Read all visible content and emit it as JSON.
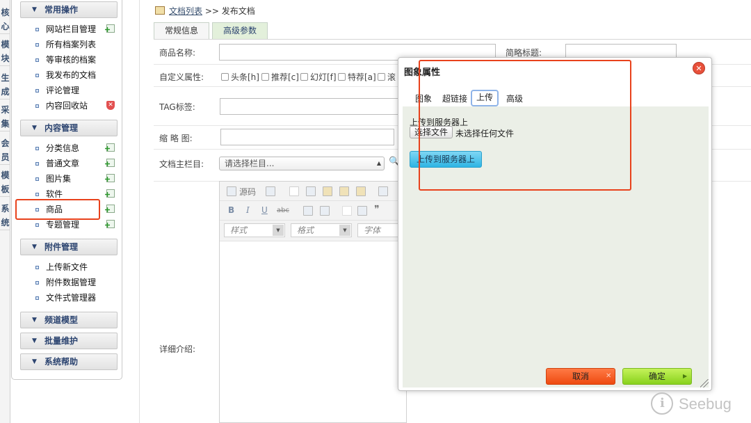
{
  "left_tabs": [
    "核心",
    "模块",
    "生成",
    "采集",
    "会员",
    "模板",
    "系统"
  ],
  "menu": {
    "groups": [
      {
        "title": "常用操作",
        "items": [
          {
            "label": "网站栏目管理",
            "action": "add"
          },
          {
            "label": "所有档案列表",
            "action": ""
          },
          {
            "label": "等审核的档案",
            "action": ""
          },
          {
            "label": "我发布的文档",
            "action": ""
          },
          {
            "label": "评论管理",
            "action": ""
          },
          {
            "label": "内容回收站",
            "action": "delete"
          }
        ]
      },
      {
        "title": "内容管理",
        "items": [
          {
            "label": "分类信息",
            "action": "add"
          },
          {
            "label": "普通文章",
            "action": "add"
          },
          {
            "label": "图片集",
            "action": "add"
          },
          {
            "label": "软件",
            "action": "add"
          },
          {
            "label": "商品",
            "action": "add"
          },
          {
            "label": "专题管理",
            "action": "add"
          }
        ]
      },
      {
        "title": "附件管理",
        "items": [
          {
            "label": "上传新文件",
            "action": ""
          },
          {
            "label": "附件数据管理",
            "action": ""
          },
          {
            "label": "文件式管理器",
            "action": ""
          }
        ]
      },
      {
        "title": "频道模型",
        "items": []
      },
      {
        "title": "批量维护",
        "items": []
      },
      {
        "title": "系统帮助",
        "items": []
      }
    ]
  },
  "breadcrumb": {
    "link": "文档列表",
    "sep": ">>",
    "current": "发布文档"
  },
  "tabs": [
    "常规信息",
    "高级参数"
  ],
  "form": {
    "product_name_label": "商品名称:",
    "short_title_label": "简略标题:",
    "custom_attr_label": "自定义属性:",
    "attrs": [
      "头条[h]",
      "推荐[c]",
      "幻灯[f]",
      "特荐[a]",
      "滚"
    ],
    "tag_label": "TAG标签:",
    "thumb_label": "缩 略 图:",
    "main_column_label": "文档主栏目:",
    "main_column_value": "请选择栏目...",
    "detail_label": "详细介绍:"
  },
  "editor": {
    "source_label": "源码",
    "style_combo": "样式",
    "format_combo": "格式",
    "font_combo": "字体",
    "bold": "B",
    "italic": "I",
    "underline": "U",
    "strike": "abc",
    "quote": "❞"
  },
  "dialog": {
    "title": "图象属性",
    "tabs": [
      "图象",
      "超链接",
      "上传",
      "高级"
    ],
    "active_tab": "上传",
    "upload_label": "上传到服务器上",
    "choose_file": "选择文件",
    "no_file": "未选择任何文件",
    "upload_button": "上传到服务器上",
    "cancel": "取消",
    "ok": "确定"
  },
  "watermark": "Seebug",
  "colors": {
    "accent_red": "#e8421c",
    "upload_blue": "#2eb5e4",
    "ok_green": "#88d21c",
    "cancel_orange": "#ee4a10"
  }
}
